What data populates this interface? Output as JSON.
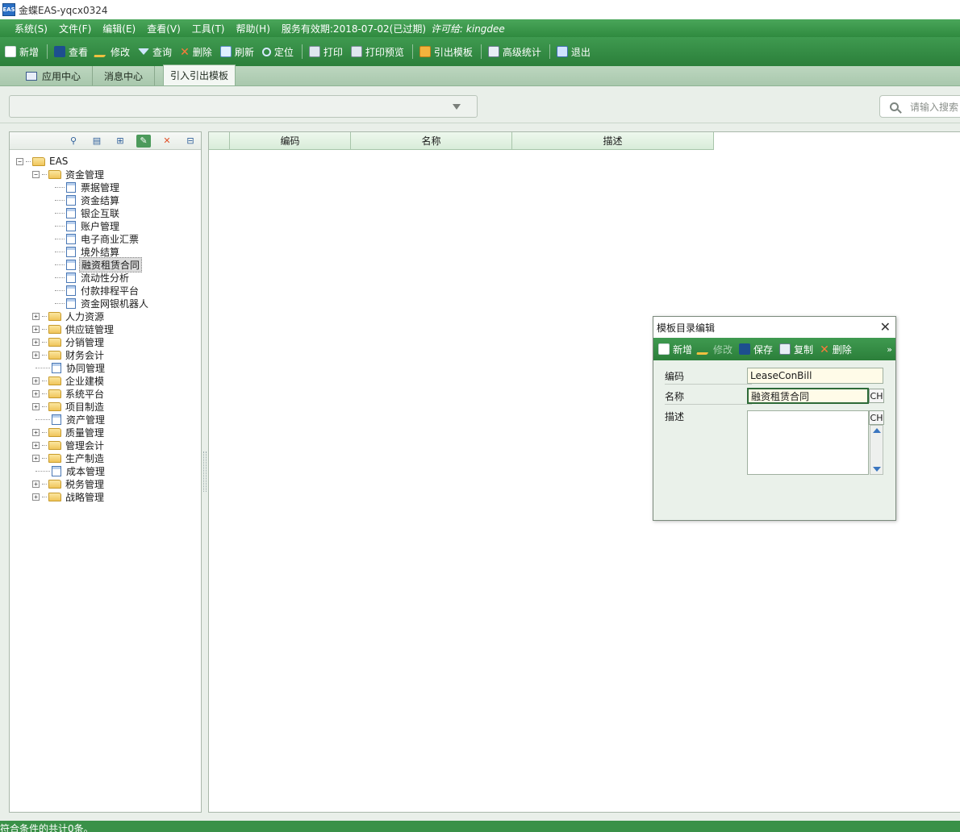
{
  "window": {
    "title": "金蝶EAS-yqcx0324",
    "icon_text": "EAS"
  },
  "menubar": {
    "items": [
      "系统(S)",
      "文件(F)",
      "编辑(E)",
      "查看(V)",
      "工具(T)",
      "帮助(H)"
    ],
    "service_text": "服务有效期:2018-07-02(已过期)",
    "license_text": "许可给:  kingdee"
  },
  "toolbar": {
    "new": "新增",
    "view": "查看",
    "edit": "修改",
    "query": "查询",
    "delete": "删除",
    "refresh": "刷新",
    "locate": "定位",
    "print": "打印",
    "print_preview": "打印预览",
    "export_template": "引出模板",
    "advanced_stats": "高级统计",
    "exit": "退出"
  },
  "tabs": {
    "app_center": "应用中心",
    "message_center": "消息中心",
    "active": "引入引出模板"
  },
  "search": {
    "placeholder": "请输入搜索"
  },
  "tree": {
    "root": "EAS",
    "fund_mgmt": "资金管理",
    "fund_children": [
      "票据管理",
      "资金结算",
      "银企互联",
      "账户管理",
      "电子商业汇票",
      "境外结算",
      "融资租赁合同",
      "流动性分析",
      "付款排程平台",
      "资金网银机器人"
    ],
    "others": [
      {
        "label": "人力资源",
        "type": "folder"
      },
      {
        "label": "供应链管理",
        "type": "folder"
      },
      {
        "label": "分销管理",
        "type": "folder"
      },
      {
        "label": "财务会计",
        "type": "folder"
      },
      {
        "label": "协同管理",
        "type": "leaf"
      },
      {
        "label": "企业建模",
        "type": "folder"
      },
      {
        "label": "系统平台",
        "type": "folder"
      },
      {
        "label": "项目制造",
        "type": "folder"
      },
      {
        "label": "资产管理",
        "type": "leaf"
      },
      {
        "label": "质量管理",
        "type": "folder"
      },
      {
        "label": "管理会计",
        "type": "folder"
      },
      {
        "label": "生产制造",
        "type": "folder"
      },
      {
        "label": "成本管理",
        "type": "leaf"
      },
      {
        "label": "税务管理",
        "type": "folder"
      },
      {
        "label": "战略管理",
        "type": "folder"
      }
    ]
  },
  "table": {
    "columns": [
      "编码",
      "名称",
      "描述"
    ]
  },
  "dialog": {
    "title": "模板目录编辑",
    "toolbar": {
      "new": "新增",
      "edit": "修改",
      "save": "保存",
      "copy": "复制",
      "delete": "删除"
    },
    "code_label": "编码",
    "code_value": "LeaseConBill",
    "name_label": "名称",
    "name_value": "融资租赁合同",
    "desc_label": "描述",
    "lang_button": "CH"
  },
  "status": {
    "text": "符合条件的共计0条。"
  }
}
